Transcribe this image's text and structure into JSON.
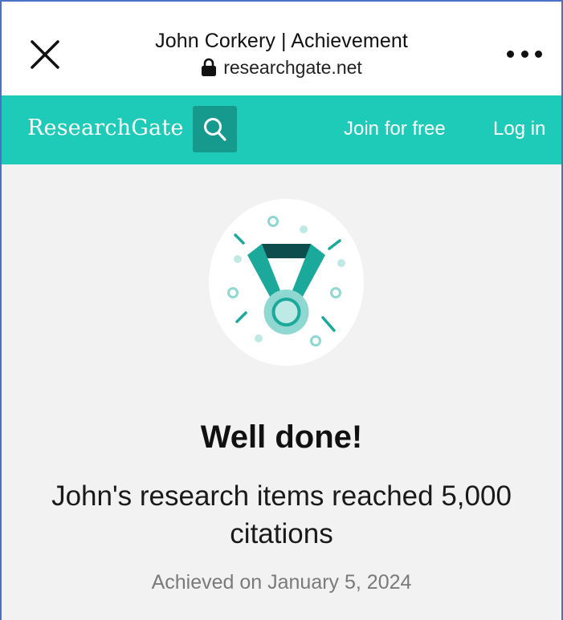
{
  "browser": {
    "page_title": "John Corkery | Achievement",
    "url": "researchgate.net",
    "close_icon": "close-icon",
    "lock_icon": "lock-icon",
    "more_icon": "more-horizontal-icon"
  },
  "site_header": {
    "logo": "ResearchGate",
    "search_icon": "search-icon",
    "join_label": "Join for free",
    "login_label": "Log in",
    "background_color": "#1ecbb8",
    "search_button_color": "#169a8d"
  },
  "achievement": {
    "badge_icon": "medal-icon",
    "headline": "Well done!",
    "message": "John's research items reached 5,000 citations",
    "date": "Achieved on January 5, 2024"
  }
}
